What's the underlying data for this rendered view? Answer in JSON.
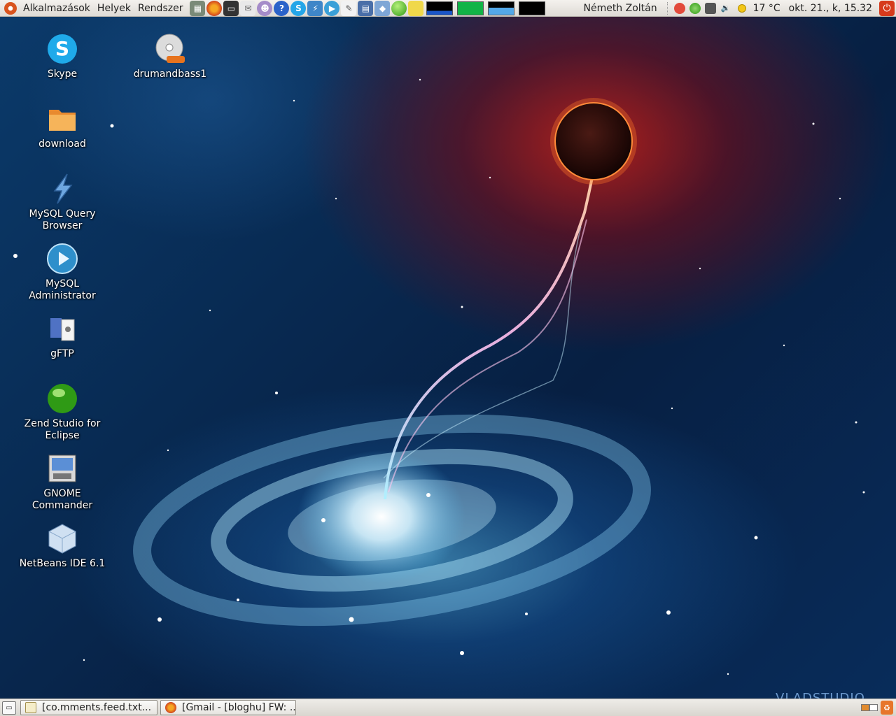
{
  "top_panel": {
    "menus": [
      "Alkalmazások",
      "Helyek",
      "Rendszer"
    ],
    "user": "Németh Zoltán",
    "temperature": "17 °C",
    "datetime": "okt. 21., k, 15.32"
  },
  "desktop_icons": [
    {
      "label": "Skype",
      "icon": "skype-icon"
    },
    {
      "label": "drumandbass1",
      "icon": "dvd-disc-icon",
      "badge": "DVD-R"
    },
    {
      "label": "download",
      "icon": "folder-icon"
    },
    {
      "label": "MySQL Query Browser",
      "icon": "lightning-icon"
    },
    {
      "label": "MySQL Administrator",
      "icon": "play-icon"
    },
    {
      "label": "gFTP",
      "icon": "gftp-icon"
    },
    {
      "label": "Zend Studio for Eclipse",
      "icon": "green-ball-icon"
    },
    {
      "label": "GNOME Commander",
      "icon": "file-manager-icon"
    },
    {
      "label": "NetBeans IDE 6.1",
      "icon": "cube-icon"
    }
  ],
  "taskbar": {
    "tasks": [
      {
        "label": "[co.mments.feed.txt...",
        "icon": "text-editor-icon"
      },
      {
        "label": "[Gmail - [bloghu] FW: ...",
        "icon": "firefox-icon"
      }
    ]
  },
  "wallpaper": {
    "watermark": "VLADSTUDIO"
  },
  "colors": {
    "panel_top": "#f4f2ee",
    "panel_bottom": "#dedbd5",
    "ubuntu_orange": "#d9541e",
    "wallpaper_blue": "#0b3a6a",
    "wallpaper_red": "#c81e14"
  }
}
